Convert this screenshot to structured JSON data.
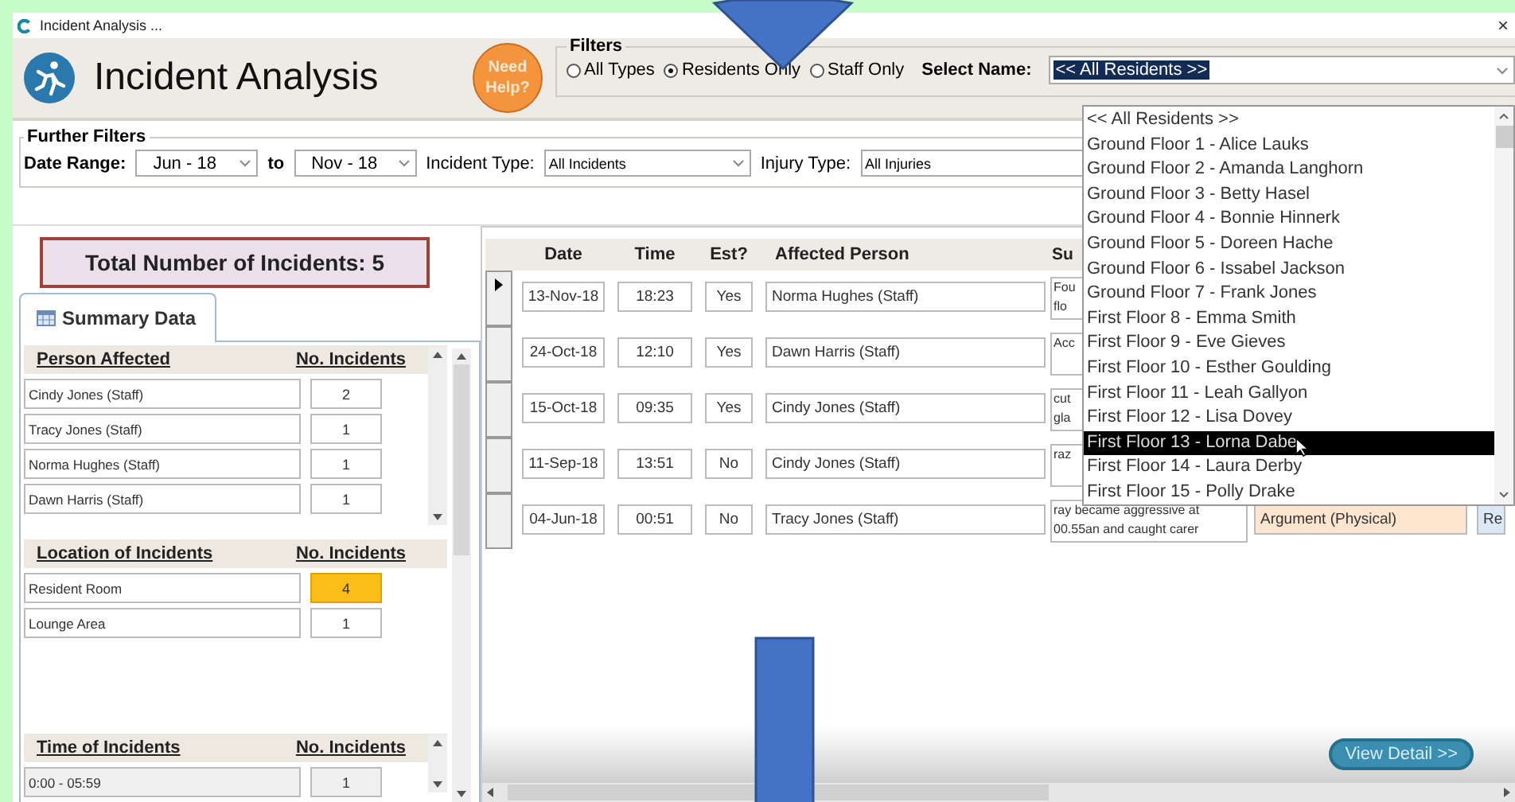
{
  "window": {
    "title": "Incident Analysis ...",
    "close": "×"
  },
  "header": {
    "title": "Incident Analysis",
    "help": "Need Help?"
  },
  "filters": {
    "legend": "Filters",
    "options": [
      {
        "label": "All Types",
        "selected": false
      },
      {
        "label": "Residents Only",
        "selected": true
      },
      {
        "label": "Staff Only",
        "selected": false
      }
    ],
    "select_label": "Select Name:",
    "select_value": "<< All Residents >>"
  },
  "dropdown": {
    "items": [
      {
        "label": "<< All Residents >>",
        "selected": false
      },
      {
        "label": "Ground Floor 1 - Alice Lauks",
        "selected": false
      },
      {
        "label": "Ground Floor 2 - Amanda Langhorn",
        "selected": false
      },
      {
        "label": "Ground Floor 3 - Betty Hasel",
        "selected": false
      },
      {
        "label": "Ground Floor 4 - Bonnie Hinnerk",
        "selected": false
      },
      {
        "label": "Ground Floor 5 - Doreen Hache",
        "selected": false
      },
      {
        "label": "Ground Floor 6 - Issabel Jackson",
        "selected": false
      },
      {
        "label": "Ground Floor 7 - Frank Jones",
        "selected": false
      },
      {
        "label": "First Floor 8 - Emma Smith",
        "selected": false
      },
      {
        "label": "First Floor 9 - Eve Gieves",
        "selected": false
      },
      {
        "label": "First Floor 10 - Esther Goulding",
        "selected": false
      },
      {
        "label": "First Floor 11 - Leah Gallyon",
        "selected": false
      },
      {
        "label": "First Floor 12 - Lisa Dovey",
        "selected": false
      },
      {
        "label": "First Floor 13 - Lorna Dabe",
        "selected": true
      },
      {
        "label": "First Floor 14 - Laura Derby",
        "selected": false
      },
      {
        "label": "First Floor 15 - Polly Drake",
        "selected": false
      }
    ]
  },
  "further_filters": {
    "legend": "Further Filters",
    "date_label": "Date Range:",
    "from": "Jun - 18",
    "to_label": "to",
    "to": "Nov - 18",
    "incident_type_label": "Incident Type:",
    "incident_type": "All Incidents",
    "injury_type_label": "Injury Type:",
    "injury_type": "All Injuries"
  },
  "total": "Total Number of Incidents: 5",
  "summary_tab": "Summary Data",
  "sections": [
    {
      "title": "Person Affected",
      "count_heading": "No. Incidents",
      "rows": [
        {
          "name": "Cindy Jones (Staff)",
          "count": "2",
          "highlight": false
        },
        {
          "name": "Tracy Jones (Staff)",
          "count": "1",
          "highlight": false
        },
        {
          "name": "Norma Hughes (Staff)",
          "count": "1",
          "highlight": false
        },
        {
          "name": "Dawn Harris (Staff)",
          "count": "1",
          "highlight": false
        }
      ]
    },
    {
      "title": "Location of Incidents",
      "count_heading": "No. Incidents",
      "rows": [
        {
          "name": "Resident Room",
          "count": "4",
          "highlight": true
        },
        {
          "name": "Lounge Area",
          "count": "1",
          "highlight": false
        }
      ]
    },
    {
      "title": "Time of Incidents",
      "count_heading": "No. Incidents",
      "rows": [
        {
          "name": "0:00 - 05:59",
          "count": "1",
          "highlight": false
        }
      ]
    }
  ],
  "grid": {
    "columns": [
      "Date",
      "Time",
      "Est?",
      "Affected Person",
      "Su"
    ],
    "rows": [
      {
        "current": true,
        "date": "13-Nov-18",
        "time": "18:23",
        "est": "Yes",
        "person": "Norma Hughes (Staff)",
        "summary": "Fou\nflo"
      },
      {
        "current": false,
        "date": "24-Oct-18",
        "time": "12:10",
        "est": "Yes",
        "person": "Dawn Harris (Staff)",
        "summary": "Acc"
      },
      {
        "current": false,
        "date": "15-Oct-18",
        "time": "09:35",
        "est": "Yes",
        "person": "Cindy Jones (Staff)",
        "summary": "cut\ngla"
      },
      {
        "current": false,
        "date": "11-Sep-18",
        "time": "13:51",
        "est": "No",
        "person": "Cindy Jones (Staff)",
        "summary": "raz"
      },
      {
        "current": false,
        "date": "04-Jun-18",
        "time": "00:51",
        "est": "No",
        "person": "Tracy Jones (Staff)",
        "summary": "ray became aggressive at\n00.55an and caught carer",
        "type": "Argument (Physical)",
        "column_8": "Re"
      }
    ]
  },
  "view_detail": "View Detail >>"
}
